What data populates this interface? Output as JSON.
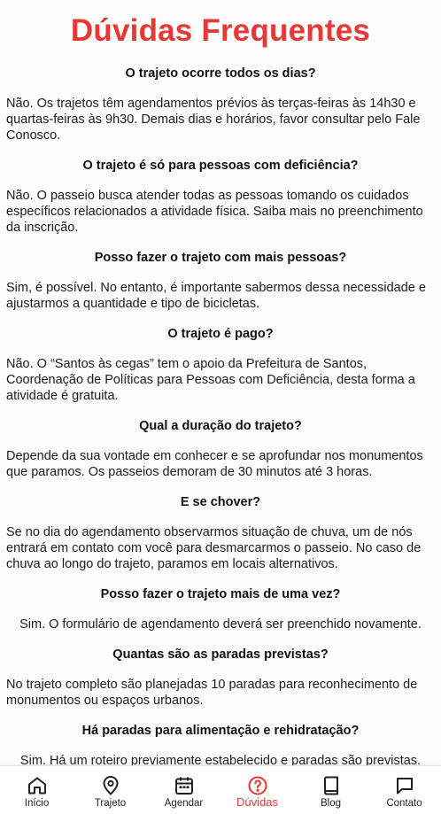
{
  "page": {
    "title": "Dúvidas Frequentes"
  },
  "colors": {
    "accent": "#e53935",
    "text": "#1a1a1a",
    "background": "#fcfcfd"
  },
  "faq": [
    {
      "question": "O trajeto ocorre todos os dias?",
      "answer": "Não. Os trajetos têm agendamentos prévios às terças-feiras às 14h30 e quartas-feiras às 9h30. Demais dias e horários, favor consultar pelo Fale Conosco."
    },
    {
      "question": "O trajeto é só para pessoas com deficiência?",
      "answer": "Não. O passeio busca atender todas as pessoas tomando os cuidados específicos relacionados a atividade física. Saiba mais no preenchimento da inscrição."
    },
    {
      "question": "Posso fazer o trajeto com mais pessoas?",
      "answer": "Sim, é possível. No entanto, é importante sabermos dessa necessidade e ajustarmos a quantidade e tipo de bicicletas."
    },
    {
      "question": "O trajeto é pago?",
      "answer": "Não. O “Santos às cegas” tem o apoio da Prefeitura de Santos, Coordenação de Políticas para Pessoas com Deficiência, desta forma a atividade é gratuita."
    },
    {
      "question": "Qual a duração do trajeto?",
      "answer": "Depende da sua vontade em conhecer e se aprofundar nos monumentos que paramos. Os passeios demoram de 30 minutos até 3 horas."
    },
    {
      "question": "E se chover?",
      "answer": "Se no dia do agendamento observarmos situação de chuva, um de nós entrará em contato com você para desmarcarmos o passeio. No caso de chuva ao longo do trajeto, paramos em locais alternativos."
    },
    {
      "question": "Posso fazer o trajeto mais de uma vez?",
      "answer": "Sim. O formulário de agendamento deverá ser preenchido novamente."
    },
    {
      "question": "Quantas são as paradas previstas?",
      "answer": "No trajeto completo são planejadas 10 paradas para reconhecimento de monumentos ou espaços urbanos."
    },
    {
      "question": "Há paradas para alimentação e rehidratação?",
      "answer": "Sim. Há um roteiro previamente estabelecido e paradas são previstas."
    }
  ],
  "nav": {
    "items": [
      {
        "label": "Início",
        "icon": "home-icon"
      },
      {
        "label": "Trajeto",
        "icon": "map-pin-icon"
      },
      {
        "label": "Agendar",
        "icon": "calendar-icon"
      },
      {
        "label": "Dúvidas",
        "icon": "help-circle-icon",
        "active": true
      },
      {
        "label": "Blog",
        "icon": "book-icon"
      },
      {
        "label": "Contato",
        "icon": "chat-icon"
      }
    ]
  }
}
